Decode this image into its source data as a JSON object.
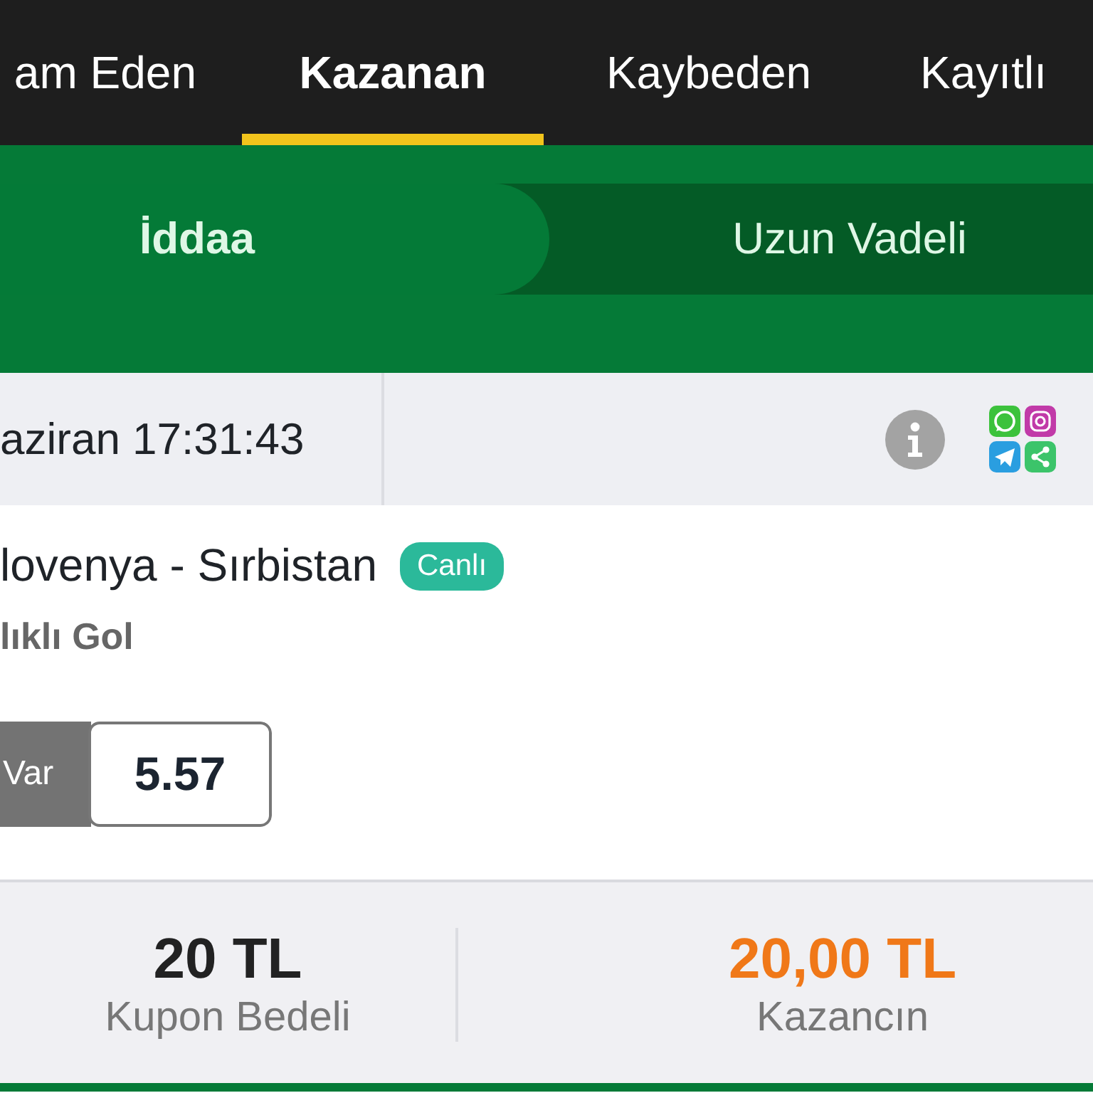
{
  "top_tabs": [
    {
      "label": "am Eden",
      "selected": false
    },
    {
      "label": "Kazanan",
      "selected": true
    },
    {
      "label": "Kaybeden",
      "selected": false
    },
    {
      "label": "Kayıtlı",
      "selected": false
    }
  ],
  "bet_types": [
    {
      "label": "İddaa",
      "selected": true
    },
    {
      "label": "Uzun Vadeli",
      "selected": false
    }
  ],
  "coupon": {
    "date": "aziran 17:31:43",
    "match": "lovenya - Sırbistan",
    "badge": "Canlı",
    "market": "lıklı Gol",
    "selection": {
      "label": "Var",
      "odds": "5.57"
    }
  },
  "summary": [
    {
      "kind": "stake",
      "amount": "20 TL",
      "label": "Kupon Bedeli"
    },
    {
      "kind": "win",
      "amount": "20,00 TL",
      "label": "Kazancın"
    }
  ]
}
